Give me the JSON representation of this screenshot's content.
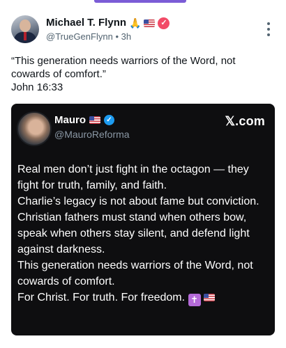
{
  "post": {
    "author_name": "Michael T. Flynn",
    "author_emoji": "🙏",
    "handle": "@TrueGenFlynn",
    "separator": "•",
    "time": "3h",
    "text_lines": [
      "“This generation needs warriors of the Word, not cowards of comfort.”",
      "John 16:33"
    ]
  },
  "quote": {
    "author_name": "Mauro",
    "handle": "@MauroReforma",
    "source": "𝕏.com",
    "paragraphs": [
      "Real men don’t just fight in the octagon — they fight for truth, family, and faith.",
      "Charlie’s legacy is not about fame but conviction.",
      "Christian fathers must stand when others bow, speak when others stay silent, and defend light against darkness.",
      "This generation needs warriors of the Word, not cowards of comfort.",
      "For Christ. For truth. For freedom."
    ],
    "cross_glyph": "✝"
  },
  "icons": {
    "more": "more-vertical-icon",
    "verified_main": "verified-badge-icon",
    "verified_quote": "verified-badge-icon",
    "flag": "us-flag-icon"
  },
  "colors": {
    "accent": "#7b5cd6",
    "verified_main": "#f24b67",
    "verified_quote": "#1d9bf0",
    "card_bg": "#0e0e10",
    "cross_bg": "#b46ad8"
  }
}
